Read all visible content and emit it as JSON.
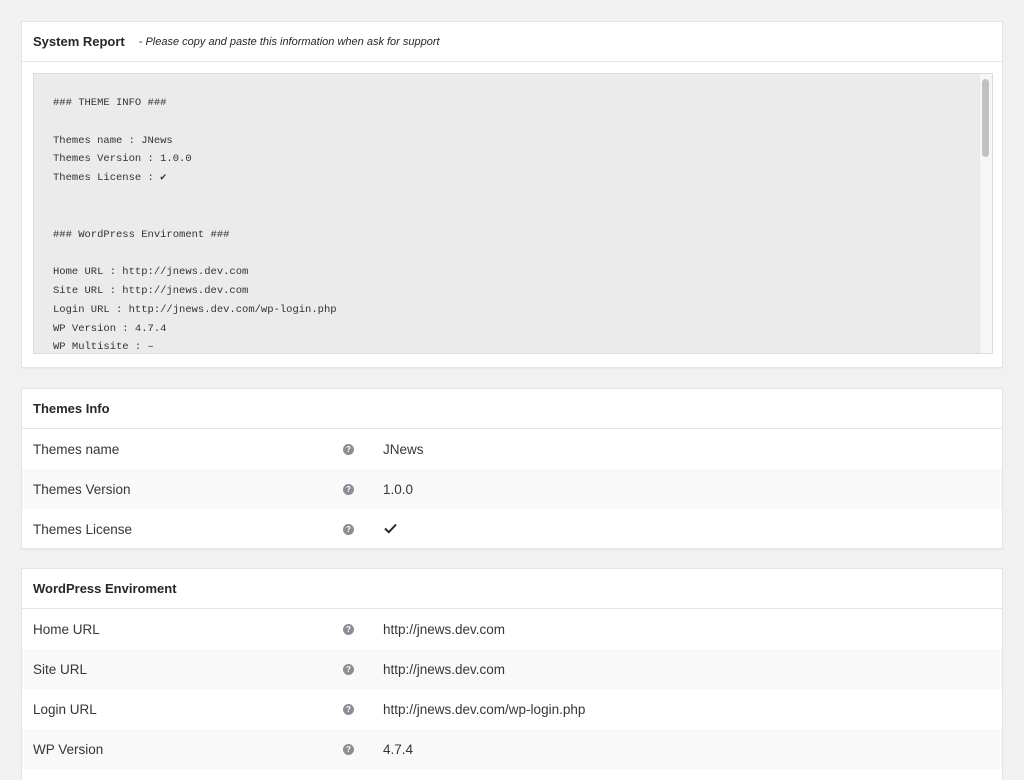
{
  "system_report": {
    "title": "System Report",
    "subtitle": "- Please copy and paste this information when ask for support",
    "lines": [
      "### THEME INFO ###",
      "",
      "Themes name : JNews",
      "Themes Version : 1.0.0",
      "Themes License : ✔",
      "",
      "",
      "### WordPress Enviroment ###",
      "",
      "Home URL : http://jnews.dev.com",
      "Site URL : http://jnews.dev.com",
      "Login URL : http://jnews.dev.com/wp-login.php",
      "WP Version : 4.7.4",
      "WP Multisite : –"
    ]
  },
  "themes_info": {
    "title": "Themes Info",
    "rows": [
      {
        "label": "Themes name",
        "value": "JNews"
      },
      {
        "label": "Themes Version",
        "value": "1.0.0"
      },
      {
        "label": "Themes License",
        "value": "",
        "icon": "check-icon"
      }
    ]
  },
  "wp_environment": {
    "title": "WordPress Enviroment",
    "rows": [
      {
        "label": "Home URL",
        "value": "http://jnews.dev.com"
      },
      {
        "label": "Site URL",
        "value": "http://jnews.dev.com"
      },
      {
        "label": "Login URL",
        "value": "http://jnews.dev.com/wp-login.php"
      },
      {
        "label": "WP Version",
        "value": "4.7.4"
      }
    ]
  },
  "help_icon_glyph": "?",
  "colors": {
    "background": "#f1f1f1",
    "panel": "#ffffff",
    "report_box": "#ebebeb",
    "row_alt": "#f9f9f9",
    "help_icon": "#8a8f95"
  }
}
